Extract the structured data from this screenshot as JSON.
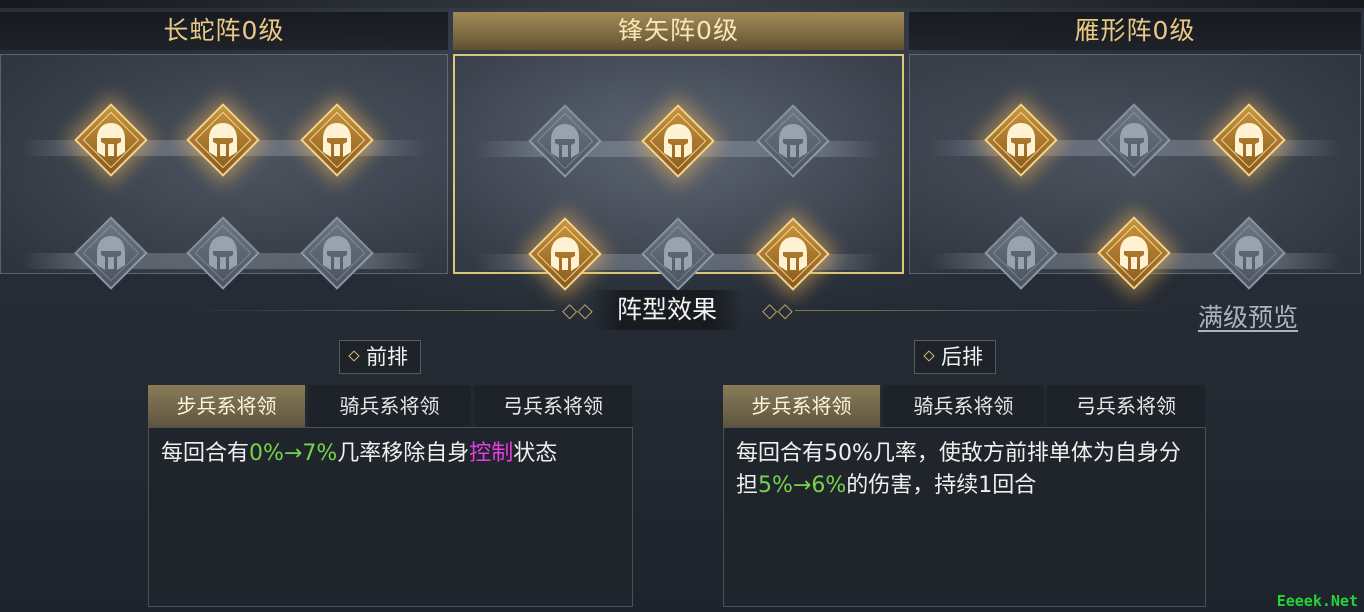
{
  "formations": [
    {
      "name": "长蛇阵0级",
      "selected": false,
      "front": [
        true,
        true,
        true
      ],
      "back": [
        false,
        false,
        false
      ]
    },
    {
      "name": "锋矢阵0级",
      "selected": true,
      "front": [
        false,
        true,
        false
      ],
      "back": [
        true,
        false,
        true
      ]
    },
    {
      "name": "雁形阵0级",
      "selected": false,
      "front": [
        true,
        false,
        true
      ],
      "back": [
        false,
        true,
        false
      ]
    }
  ],
  "effects": {
    "title": "阵型效果",
    "preview_label": "满级预览"
  },
  "front": {
    "label": "前排",
    "tabs": [
      "步兵系将领",
      "骑兵系将领",
      "弓兵系将领"
    ],
    "selected_tab": 0,
    "desc": {
      "t1": "每回合有",
      "g1": "0%→7%",
      "t2": "几率移除自身",
      "m1": "控制",
      "t3": "状态"
    }
  },
  "back": {
    "label": "后排",
    "tabs": [
      "步兵系将领",
      "骑兵系将领",
      "弓兵系将领"
    ],
    "selected_tab": 0,
    "desc": {
      "t1": "每回合有50%几率，使敌方前排单体为自身分担",
      "g1": "5%→6%",
      "t2": "的伤害，持续1回合"
    }
  },
  "watermark": "Eeeek.Net",
  "colors": {
    "gold": "#e9c983",
    "highlight_green": "#76d34a",
    "highlight_magenta": "#e53ee0"
  },
  "icons": {
    "slot": "helmet-icon",
    "tag": "diamond-icon"
  }
}
